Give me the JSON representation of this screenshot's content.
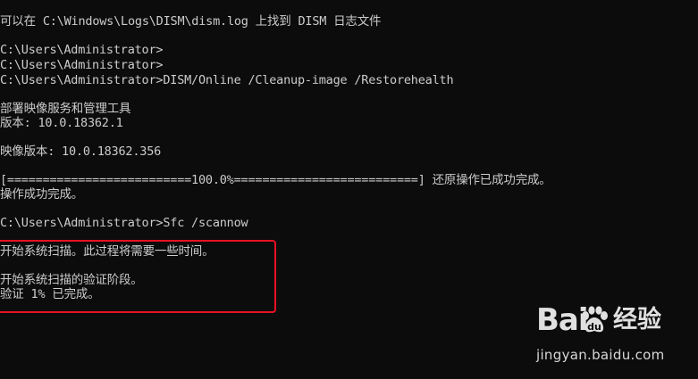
{
  "console": {
    "lines": {
      "l0": "------- ------- --- --- -- ------ -- -- ---------",
      "l1": "可以在 C:\\Windows\\Logs\\DISM\\dism.log 上找到 DISM 日志文件",
      "l2": "C:\\Users\\Administrator>",
      "l3": "C:\\Users\\Administrator>",
      "l4": "C:\\Users\\Administrator>DISM/Online /Cleanup-image /Restorehealth",
      "l5": "部署映像服务和管理工具",
      "l6": "版本: 10.0.18362.1",
      "l7": "映像版本: 10.0.18362.356",
      "l8": "[==========================100.0%==========================] 还原操作已成功完成。",
      "l9": "操作成功完成。",
      "l10": "C:\\Users\\Administrator>Sfc /scannow",
      "l11": "开始系统扫描。此过程将需要一些时间。",
      "l12": "开始系统扫描的验证阶段。",
      "l13": "验证 1% 已完成。"
    }
  },
  "watermark": {
    "brand_latin": "Bai",
    "brand_cn": "经验",
    "url": "jingyan.baidu.com"
  },
  "colors": {
    "background": "#0c0c0c",
    "text": "#cccccc",
    "highlight": "#e81123"
  }
}
